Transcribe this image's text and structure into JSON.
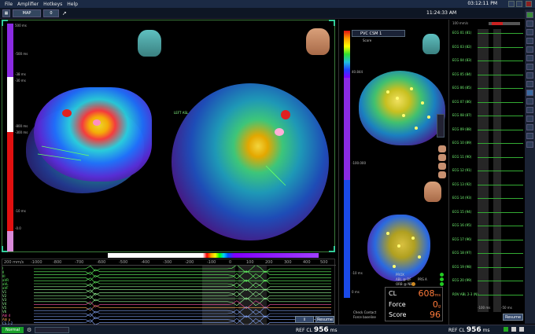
{
  "menu": {
    "items": [
      "File",
      "Amplifier",
      "Hotkeys",
      "Help"
    ],
    "clock": "03:12:11 PM"
  },
  "toolbar": {
    "map_label": "MAP",
    "map_index": "0",
    "study_time": "11:24:33 AM"
  },
  "left_panel": {
    "scale_labels": [
      "500 ms",
      "-500 ms",
      "-38 ms",
      "-30 ms",
      "-800 ms",
      "-300 ms",
      "-10 ms",
      "-0.0"
    ],
    "lat_label": "LEFT ASL",
    "egm_scale": [
      "200 mm/s",
      "-1000",
      "-800",
      "-700",
      "-600",
      "-500",
      "-400",
      "-300",
      "-200",
      "-100",
      "0",
      "100",
      "200",
      "300",
      "400",
      "500"
    ],
    "egm_channels": [
      "I",
      "II",
      "III",
      "aVR",
      "aVL",
      "aVF",
      "V1",
      "V2",
      "V3",
      "V4",
      "V5",
      "V6",
      "Abl d",
      "Abl p",
      "CS 1-2",
      "CS 3-4",
      "CS 5-6",
      "CS 7-8",
      "CS 9-10"
    ],
    "egm_range": "0",
    "resume_label": "Resume"
  },
  "mid_panel": {
    "map_name": "PVC CSM 1",
    "sub_label": "Score",
    "bar_values": [
      "40.844",
      "-100.000",
      "-10 ms",
      "0 ms"
    ],
    "legend": [
      "PROX",
      "ABL @ DF",
      "PRS A",
      "ORB @ NB"
    ],
    "check_contact": "Check Contact",
    "force_baseline": "Force baseline",
    "cl_label": "CL",
    "cl_value": "608",
    "cl_unit": "ms",
    "force_label": "Force",
    "force_value": "0",
    "force_unit": "g",
    "score_label": "Score",
    "score_value": "96"
  },
  "right_panel": {
    "speed": "100 mm/s",
    "channels": [
      "ECG 01 (81)",
      "ECG 03 (82)",
      "ECG 04 (83)",
      "ECG 05 (84)",
      "ECG 06 (85)",
      "ECG 07 (86)",
      "ECG 08 (87)",
      "ECG 09 (88)",
      "ECG 10 (89)",
      "ECG 11 (90)",
      "ECG 12 (91)",
      "ECG 13 (92)",
      "ECG 14 (93)",
      "ECG 15 (94)",
      "ECG 16 (95)",
      "ECG 17 (96)",
      "ECG 18 (97)",
      "ECG 19 (98)",
      "ECG 20 (99)",
      "ROV ABL 2-3 (N)"
    ],
    "timeline_labels": [
      "-100 ms",
      "-50 ms"
    ],
    "resume_label": "Resume"
  },
  "status": {
    "mode": "Normal",
    "ref_label_left": "REF",
    "cl_label_left": "CL",
    "cl_value_left": "956",
    "unit_left": "ms",
    "ref_label_right": "REF",
    "cl_label_right": "CL",
    "cl_value_right": "956",
    "unit_right": "ms"
  },
  "colors": {
    "accent": "#1aa02a",
    "cl_value": "#ff7a3a",
    "trace_green": "#3a3"
  }
}
